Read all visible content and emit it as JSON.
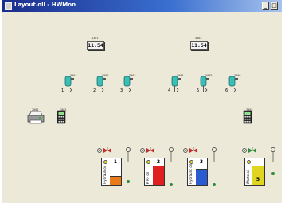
{
  "window": {
    "title": "Layout.oll - HWMon",
    "min_label": "_",
    "max_label": "□"
  },
  "displays": [
    {
      "tag": "4301",
      "value": "11.54"
    },
    {
      "tag": "4302",
      "value": "11.54"
    }
  ],
  "sensors": [
    {
      "tag": "3001",
      "number": "1"
    },
    {
      "tag": "3002",
      "number": "2"
    },
    {
      "tag": "3003",
      "number": "3"
    },
    {
      "tag": "3004",
      "number": "4"
    },
    {
      "tag": "3005",
      "number": "5"
    },
    {
      "tag": "3006",
      "number": "6"
    }
  ],
  "controllers": [
    {
      "tag": "2001"
    },
    {
      "tag": "2002"
    },
    {
      "tag": "3003"
    }
  ],
  "tanks": [
    {
      "number": "1",
      "label": "Hydrauli oil",
      "fill": "#e87a1a"
    },
    {
      "number": "2",
      "label": "P. RF oil",
      "fill": "#e02020"
    },
    {
      "number": "3",
      "label": "Hydraulic oil",
      "fill": "#2a5bd0"
    },
    {
      "number": "5",
      "label": "Waste oil",
      "fill": "#e0d520"
    }
  ],
  "colors": {
    "titlebar_start": "#1a2d8c",
    "titlebar_end": "#a8c4ec",
    "canvas": "#ece9d8"
  }
}
